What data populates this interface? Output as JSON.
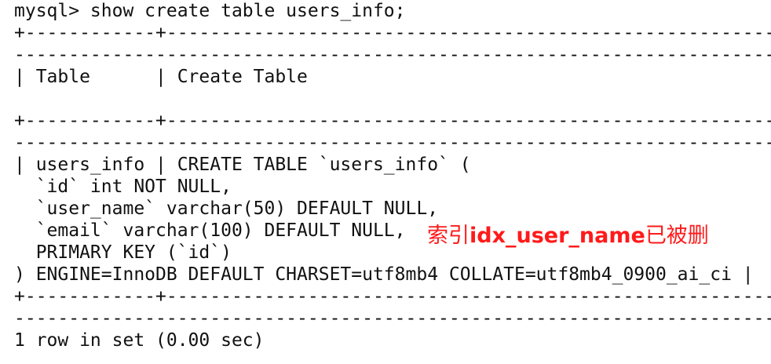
{
  "prompt_line": "mysql> show create table users_info;",
  "border_top": "+------------+---------------------------------------------------------------------------",
  "border_cont": "----------------------------------------------------------------------------------------",
  "header_row": "| Table      | Create Table",
  "border_mid": "+------------+---------------------------------------------------------------------------",
  "border_mid_cont": "----------------------------------------------------------------------------------------",
  "data_lines": [
    "| users_info | CREATE TABLE `users_info` (",
    "  `id` int NOT NULL,",
    "  `user_name` varchar(50) DEFAULT NULL,",
    "  `email` varchar(100) DEFAULT NULL,",
    "  PRIMARY KEY (`id`)",
    ") ENGINE=InnoDB DEFAULT CHARSET=utf8mb4 COLLATE=utf8mb4_0900_ai_ci |"
  ],
  "border_bottom": "+------------+---------------------------------------------------------------------------",
  "border_bottom_cont": "----------------------------------------------------------------------------------------",
  "result_line": "1 row in set (0.00 sec)",
  "annotation": {
    "prefix": "索引",
    "index_name": "idx_user_name",
    "suffix": "已被删",
    "color": "#ff1a1a"
  }
}
